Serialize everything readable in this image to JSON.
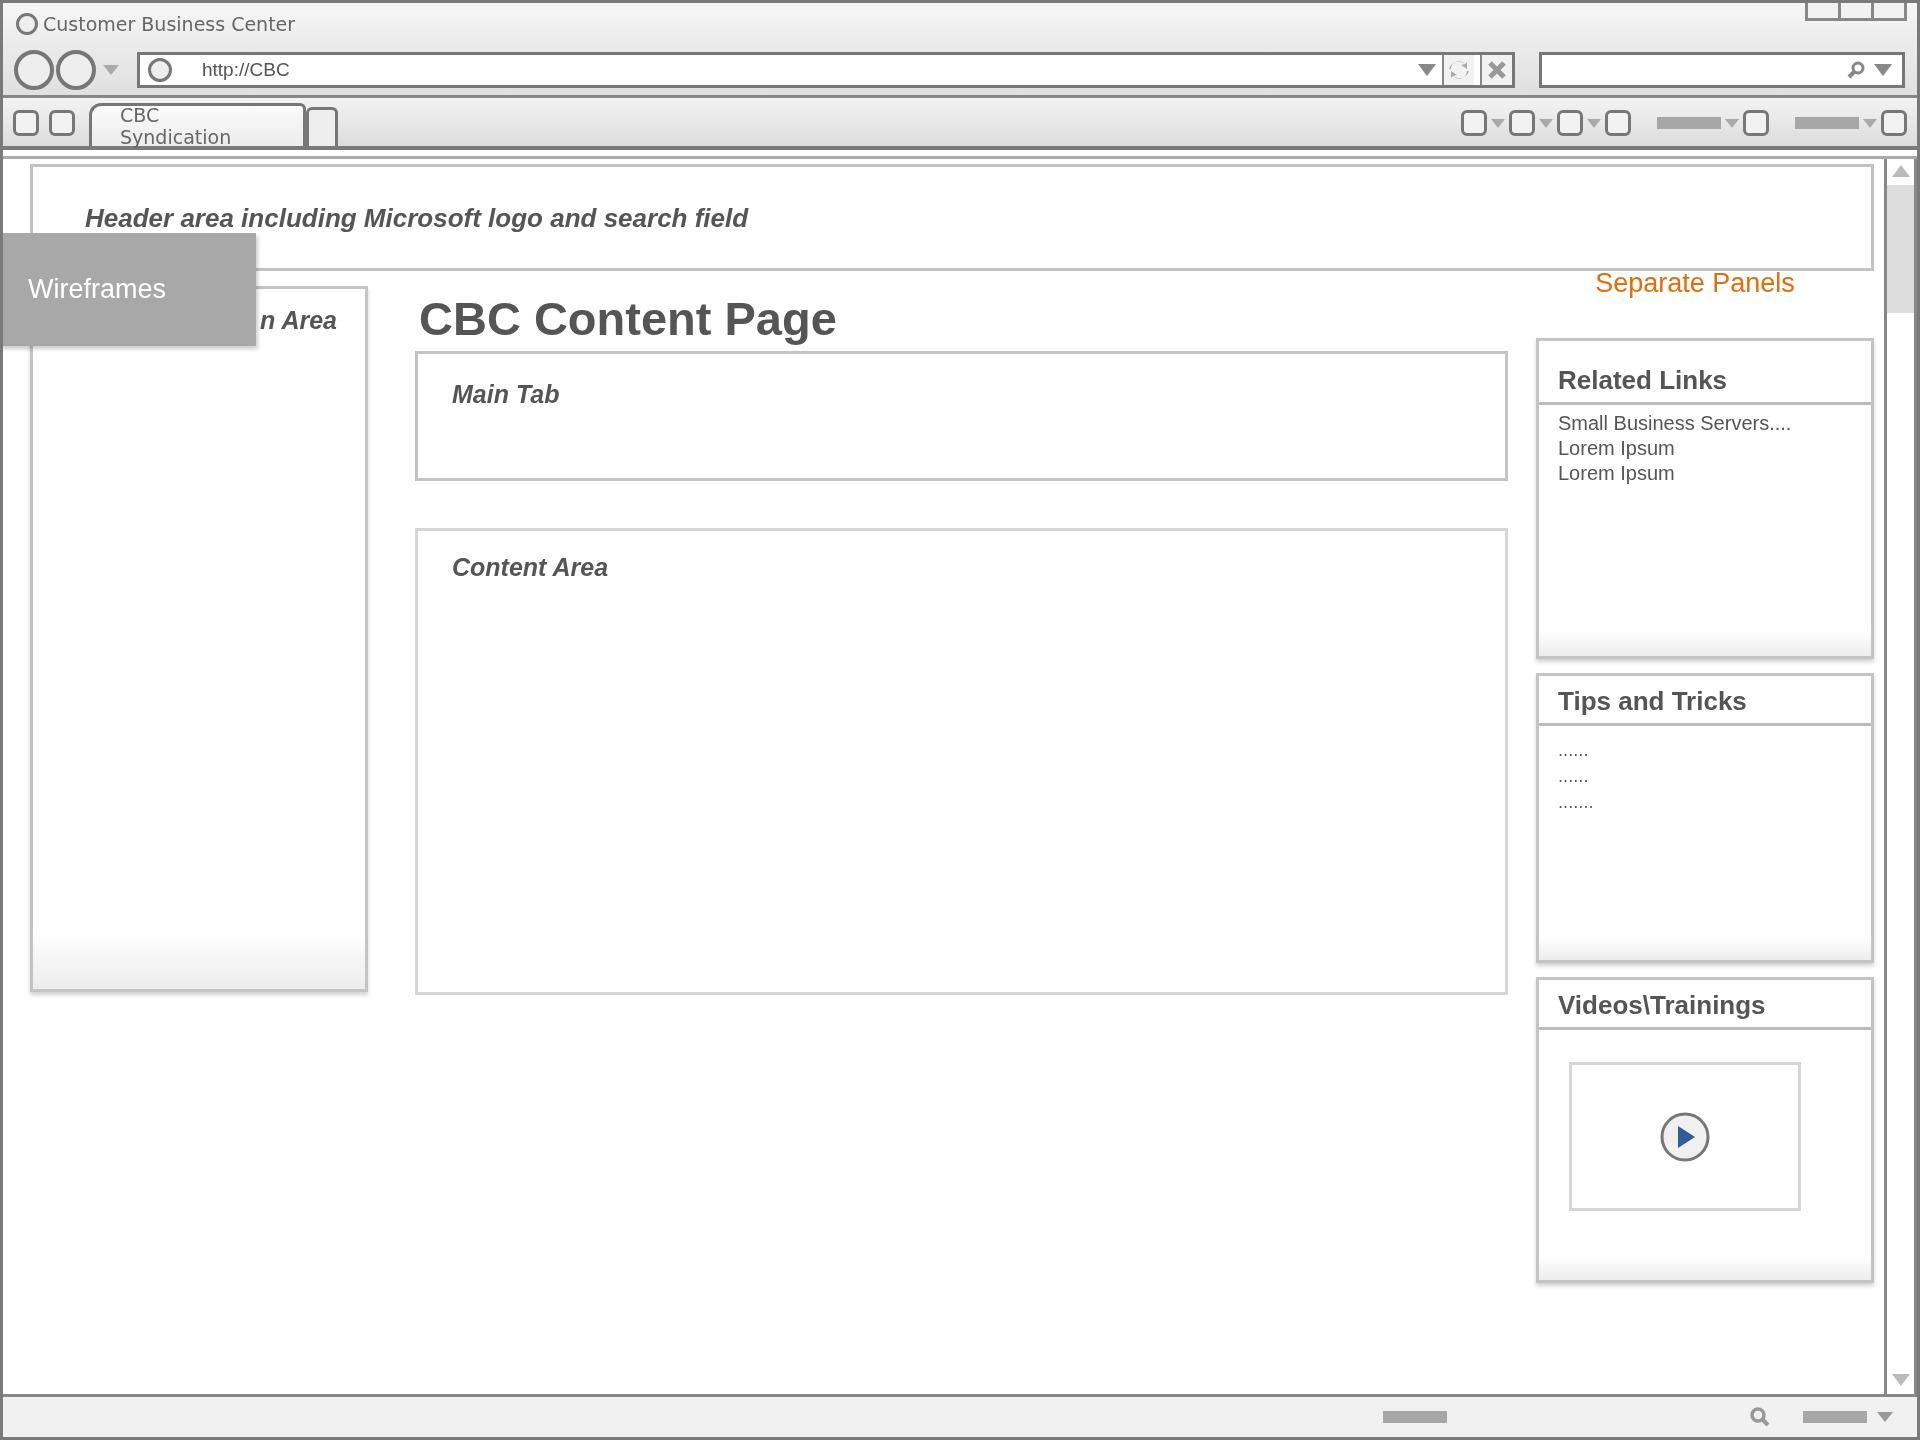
{
  "window": {
    "title": "Customer Business Center"
  },
  "address_bar": {
    "value": "http://CBC"
  },
  "tabs": [
    {
      "label": "CBC Syndication",
      "selected": true
    }
  ],
  "overlay_label": "Wireframes",
  "header": {
    "text": "Header area including Microsoft logo and search field"
  },
  "navigation": {
    "label": "n Area"
  },
  "page_title": "CBC Content Page",
  "main_tab": {
    "label": "Main Tab"
  },
  "content_area": {
    "label": "Content Area"
  },
  "side_note": "Separate Panels",
  "panels": [
    {
      "kind": "list",
      "title": "Related Links",
      "items": [
        "Small Business Servers....",
        "Lorem Ipsum",
        "Lorem Ipsum"
      ]
    },
    {
      "kind": "dots",
      "title": "Tips and Tricks",
      "items": [
        "......",
        "......",
        "......."
      ]
    },
    {
      "kind": "video",
      "title": "Videos\\Trainings"
    }
  ]
}
